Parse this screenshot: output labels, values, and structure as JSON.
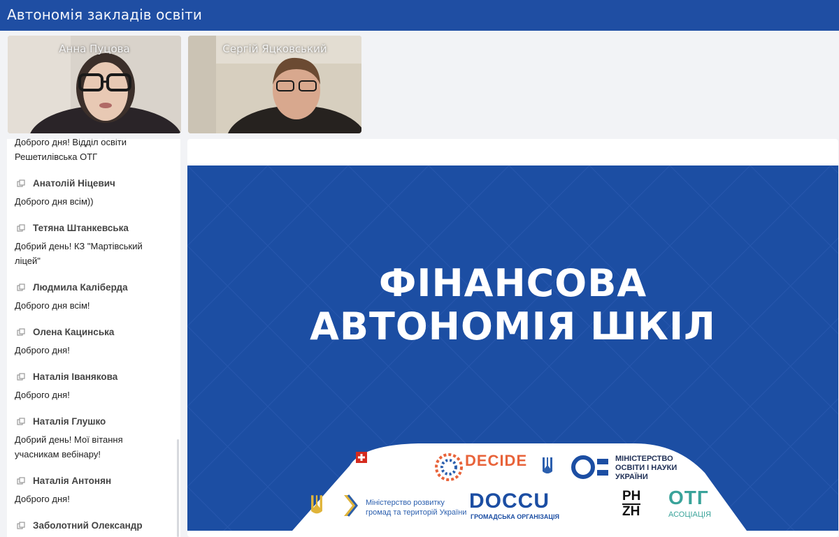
{
  "window": {
    "title": "Автономія закладів освіти"
  },
  "participants": [
    {
      "name": "Анна Пуцова"
    },
    {
      "name": "Сергій Яцковський"
    }
  ],
  "chat": {
    "messages": [
      {
        "author": "",
        "lines": [
          "Доброго дня! Відділ освіти",
          "Решетилівська ОТГ"
        ]
      },
      {
        "author": "Анатолій Ніцевич",
        "lines": [
          "Доброго дня всім))"
        ]
      },
      {
        "author": "Тетяна Штанкевська",
        "lines": [
          "Добрий день! КЗ \"Мартівський",
          "ліцей\""
        ]
      },
      {
        "author": "Людмила Каліберда",
        "lines": [
          "Доброго дня всім!"
        ]
      },
      {
        "author": "Олена Кацинська",
        "lines": [
          "Доброго дня!"
        ]
      },
      {
        "author": "Наталія Іванякова",
        "lines": [
          "Доброго дня!"
        ]
      },
      {
        "author": "Наталія Глушко",
        "lines": [
          "Добрий день! Мої вітання",
          "учасникам вебінару!"
        ]
      },
      {
        "author": "Наталія Антонян",
        "lines": [
          "Доброго дня!"
        ]
      },
      {
        "author": "Заболотний Олександр",
        "lines": []
      }
    ]
  },
  "slide": {
    "headline_line1": "ФІНАНСОВА",
    "headline_line2": "АВТОНОМІЯ ШКІЛ",
    "logos": {
      "decide": "DECIDE",
      "ministry_line1": "МІНІСТЕРСТВО",
      "ministry_line2": "ОСВІТИ І НАУКИ",
      "ministry_line3": "УКРАЇНИ",
      "minregion_line1": "Міністерство розвитку",
      "minregion_line2": "громад та територій України",
      "docu": "DOCCU",
      "docu_sub": "ГРОМАДСЬКА ОРГАНІЗАЦІЯ",
      "phzh_line1": "PH",
      "phzh_line2": "ZH",
      "otg": "ОТГ",
      "otg_sub": "АСОЦІАЦІЯ"
    }
  },
  "colors": {
    "topbar": "#1f4ea3",
    "slide_blue": "#1c4ea3"
  }
}
